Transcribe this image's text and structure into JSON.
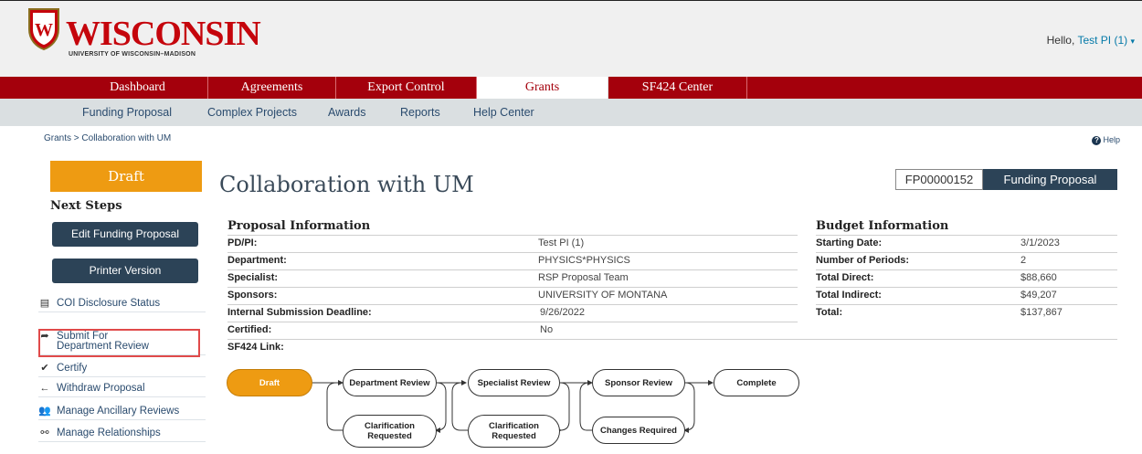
{
  "header": {
    "wordmark": "WISCONSIN",
    "submark": "UNIVERSITY OF WISCONSIN–MADISON",
    "hello_prefix": "Hello,",
    "user": "Test PI (1)",
    "crest_letter": "W"
  },
  "main_nav": [
    "Dashboard",
    "Agreements",
    "Export Control",
    "Grants",
    "SF424 Center"
  ],
  "sub_nav": [
    "Funding Proposal",
    "Complex Projects",
    "Awards",
    "Reports",
    "Help Center"
  ],
  "breadcrumb": "Grants > Collaboration with UM",
  "help_label": "Help",
  "sidebar": {
    "state": "Draft",
    "next_steps_title": "Next Steps",
    "buttons": [
      "Edit Funding Proposal",
      "Printer Version"
    ],
    "links": [
      {
        "label": "COI Disclosure Status",
        "icon": "list-icon"
      },
      {
        "label": "Submit For Department Review",
        "icon": "share-arrow-icon"
      },
      {
        "label": "Certify",
        "icon": "check-icon"
      },
      {
        "label": "Withdraw Proposal",
        "icon": "arrow-left-icon"
      },
      {
        "label": "Manage Ancillary Reviews",
        "icon": "users-icon"
      },
      {
        "label": "Manage Relationships",
        "icon": "link-icon"
      }
    ]
  },
  "title": "Collaboration with UM",
  "id_badge": "FP00000152",
  "type_badge": "Funding Proposal",
  "proposal": {
    "title": "Proposal Information",
    "rows": [
      {
        "label": "PD/PI:",
        "value": "Test PI (1)"
      },
      {
        "label": "Department:",
        "value": "PHYSICS*PHYSICS"
      },
      {
        "label": "Specialist:",
        "value": "RSP Proposal Team"
      },
      {
        "label": "Sponsors:",
        "value": "UNIVERSITY OF MONTANA"
      },
      {
        "label": "Internal Submission Deadline:",
        "value": "9/26/2022"
      },
      {
        "label": "Certified:",
        "value": "No"
      },
      {
        "label": "SF424 Link:",
        "value": ""
      }
    ]
  },
  "budget": {
    "title": "Budget Information",
    "rows": [
      {
        "label": "Starting Date:",
        "value": "3/1/2023"
      },
      {
        "label": "Number of Periods:",
        "value": "2"
      },
      {
        "label": "Total Direct:",
        "value": "$88,660"
      },
      {
        "label": "Total Indirect:",
        "value": "$49,207"
      },
      {
        "label": "Total:",
        "value": "$137,867"
      }
    ]
  },
  "workflow": {
    "draft": "Draft",
    "dept_review": "Department Review",
    "specialist_review": "Specialist Review",
    "sponsor_review": "Sponsor Review",
    "complete": "Complete",
    "clarification_1": "Clarification Requested",
    "clarification_2": "Clarification Requested",
    "changes_required": "Changes Required"
  },
  "colors": {
    "brand_red": "#a4000c",
    "draft_orange": "#ee9b12",
    "navy": "#2c4357"
  }
}
